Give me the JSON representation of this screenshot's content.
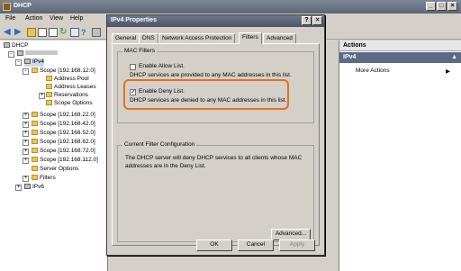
{
  "window": {
    "title": "DHCP",
    "controls": {
      "minimize": "_",
      "maximize": "□",
      "close": "×"
    }
  },
  "menu": {
    "items": [
      "File",
      "Action",
      "View",
      "Help"
    ]
  },
  "tree": {
    "root": "DHCP",
    "ipv4": "IPv4",
    "scope_main": "Scope [192.168.12.0]",
    "scope_children": [
      "Address Pool",
      "Address Leases",
      "Reservations",
      "Scope Options"
    ],
    "scopes": [
      "Scope [192.168.22.0]",
      "Scope [192.168.42.0]",
      "Scope [192.168.52.0]",
      "Scope [192.168.62.0]",
      "Scope [192.168.72.0]",
      "Scope [192.168.112.0]"
    ],
    "server_options": "Server Options",
    "filters": "Filters",
    "ipv6": "IPv6"
  },
  "actions": {
    "header": "Actions",
    "section": "IPv4",
    "more": "More Actions"
  },
  "dialog": {
    "title": "IPv4 Properties",
    "help_btn": "?",
    "close_btn": "×",
    "tabs": [
      "General",
      "DNS",
      "Network Access Protection",
      "Filters",
      "Advanced"
    ],
    "active_tab": "Filters",
    "mac_group": "MAC Filters",
    "allow_label": "Enable Allow List.",
    "allow_desc": "DHCP services are provided to any MAC addresses in this list.",
    "allow_checked": false,
    "deny_label": "Enable Deny List.",
    "deny_desc": "DHCP services are denied to any MAC addresses in this list.",
    "deny_checked": true,
    "config_group": "Current Filter Configuration",
    "config_text": "The DHCP server will deny DHCP services to all clients whose MAC addresses are in the Deny List.",
    "advanced_btn": "Advanced...",
    "ok_btn": "OK",
    "cancel_btn": "Cancel",
    "apply_btn": "Apply",
    "highlight_color": "#e07020"
  }
}
